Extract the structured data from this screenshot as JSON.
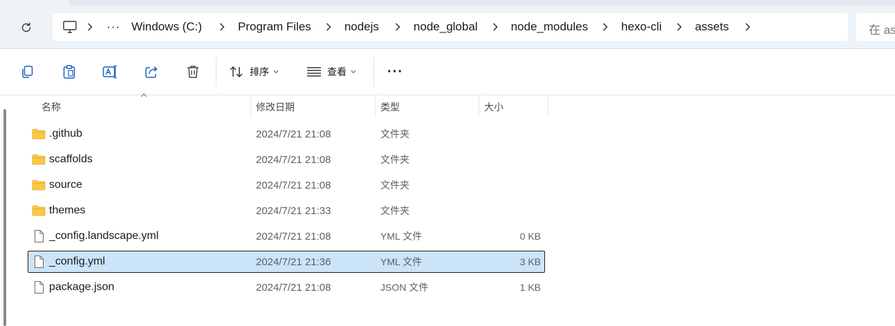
{
  "address_bar": {
    "crumbs": [
      "Windows (C:)",
      "Program Files",
      "nodejs",
      "node_global",
      "node_modules",
      "hexo-cli",
      "assets"
    ],
    "ellipsis": "···"
  },
  "search": {
    "placeholder": "在 as"
  },
  "toolbar": {
    "sort_label": "排序",
    "view_label": "查看",
    "more_label": "···"
  },
  "columns": {
    "name": "名称",
    "date": "修改日期",
    "type": "类型",
    "size": "大小"
  },
  "files": [
    {
      "name": ".github",
      "date": "2024/7/21 21:08",
      "type": "文件夹",
      "size": "",
      "kind": "folder"
    },
    {
      "name": "scaffolds",
      "date": "2024/7/21 21:08",
      "type": "文件夹",
      "size": "",
      "kind": "folder"
    },
    {
      "name": "source",
      "date": "2024/7/21 21:08",
      "type": "文件夹",
      "size": "",
      "kind": "folder"
    },
    {
      "name": "themes",
      "date": "2024/7/21 21:33",
      "type": "文件夹",
      "size": "",
      "kind": "folder"
    },
    {
      "name": "_config.landscape.yml",
      "date": "2024/7/21 21:08",
      "type": "YML 文件",
      "size": "0 KB",
      "kind": "file"
    },
    {
      "name": "_config.yml",
      "date": "2024/7/21 21:36",
      "type": "YML 文件",
      "size": "3 KB",
      "kind": "file",
      "selected": true
    },
    {
      "name": "package.json",
      "date": "2024/7/21 21:08",
      "type": "JSON 文件",
      "size": "1 KB",
      "kind": "file"
    }
  ],
  "colors": {
    "selection": "#cce4f7",
    "folder": "#f8c945",
    "accent": "#1f5fbf"
  }
}
